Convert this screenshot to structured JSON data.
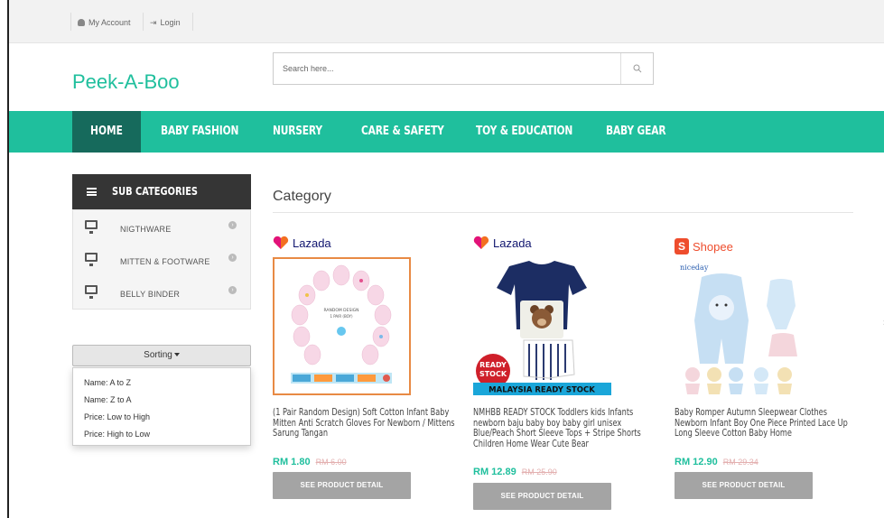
{
  "topbar": {
    "my_account": "My Account",
    "login": "Login"
  },
  "brand": {
    "logo": "Peek-A-Boo",
    "accent": "#1fbf9d",
    "nav_active": "#166a5c"
  },
  "search": {
    "placeholder": "Search here...",
    "value": ""
  },
  "nav": {
    "items": [
      "HOME",
      "BABY FASHION",
      "NURSERY",
      "CARE & SAFETY",
      "TOY & EDUCATION",
      "BABY GEAR"
    ],
    "active": "HOME"
  },
  "sidebar": {
    "title": "SUB CATEGORIES",
    "items": [
      {
        "label": "NIGTHWARE",
        "icon": "monitor-icon"
      },
      {
        "label": "MITTEN & FOOTWARE",
        "icon": "monitor-icon"
      },
      {
        "label": "BELLY BINDER",
        "icon": "monitor-icon"
      }
    ]
  },
  "sorting": {
    "label": "Sorting",
    "options": [
      "Name: A to Z",
      "Name: Z to A",
      "Price: Low to High",
      "Price: High to Low"
    ]
  },
  "main": {
    "title": "Category",
    "products": [
      {
        "store": "Lazada",
        "name": "(1 Pair Random Design) Soft Cotton Infant Baby Mitten Anti Scratch Gloves For Newborn / Mittens Sarung Tangan",
        "price": "RM 1.80",
        "old_price": "RM 6.00",
        "button": "SEE PRODUCT DETAIL",
        "image_text": "RANDOM DESIGN 1 PAIR (BOY)"
      },
      {
        "store": "Lazada",
        "name": "NMHBB READY STOCK Toddlers kids Infants newborn baju baby boy baby girl unisex Blue/Peach Short Sleeve Tops + Stripe Shorts Children Home Wear Cute Bear",
        "price": "RM 12.89",
        "old_price": "RM 25.90",
        "button": "SEE PRODUCT DETAIL",
        "image_text": "MALAYSIA READY STOCK",
        "badge": "READY STOCK"
      },
      {
        "store": "Shopee",
        "name": "Baby Romper Autumn Sleepwear Clothes Newborn Infant Boy One Piece Printed Lace Up Long Sleeve Cotton Baby Home",
        "price": "RM 12.90",
        "old_price": "RM 29.34",
        "button": "SEE PRODUCT DETAIL",
        "image_text": "niceday"
      }
    ]
  }
}
